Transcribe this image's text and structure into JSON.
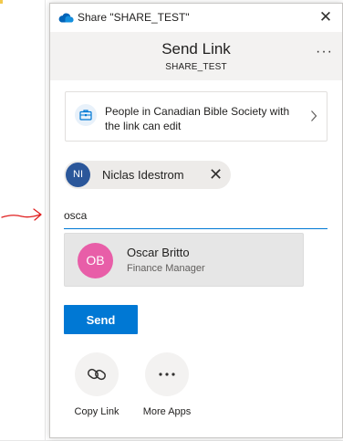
{
  "window": {
    "title": "Share \"SHARE_TEST\"",
    "close_glyph": "✕",
    "app_icon": "onedrive-cloud-icon",
    "accent_color": "#0078d4"
  },
  "header": {
    "title": "Send Link",
    "subtitle": "SHARE_TEST",
    "more_glyph": "···"
  },
  "permission": {
    "text": "People in Canadian Bible Society with the link can edit",
    "icon": "briefcase-icon"
  },
  "recipients": [
    {
      "initials": "NI",
      "name": "Niclas Idestrom",
      "avatar_color": "#2b579a",
      "remove_glyph": "✕"
    }
  ],
  "search": {
    "value": "osca",
    "placeholder": ""
  },
  "suggestions": [
    {
      "initials": "OB",
      "name": "Oscar Britto",
      "role": "Finance Manager",
      "avatar_color": "#e85ea8"
    }
  ],
  "send_label": "Send",
  "actions": [
    {
      "label": "Copy Link",
      "icon": "link-icon"
    },
    {
      "label": "More Apps",
      "icon": "more-apps-icon",
      "glyph": "···"
    }
  ]
}
